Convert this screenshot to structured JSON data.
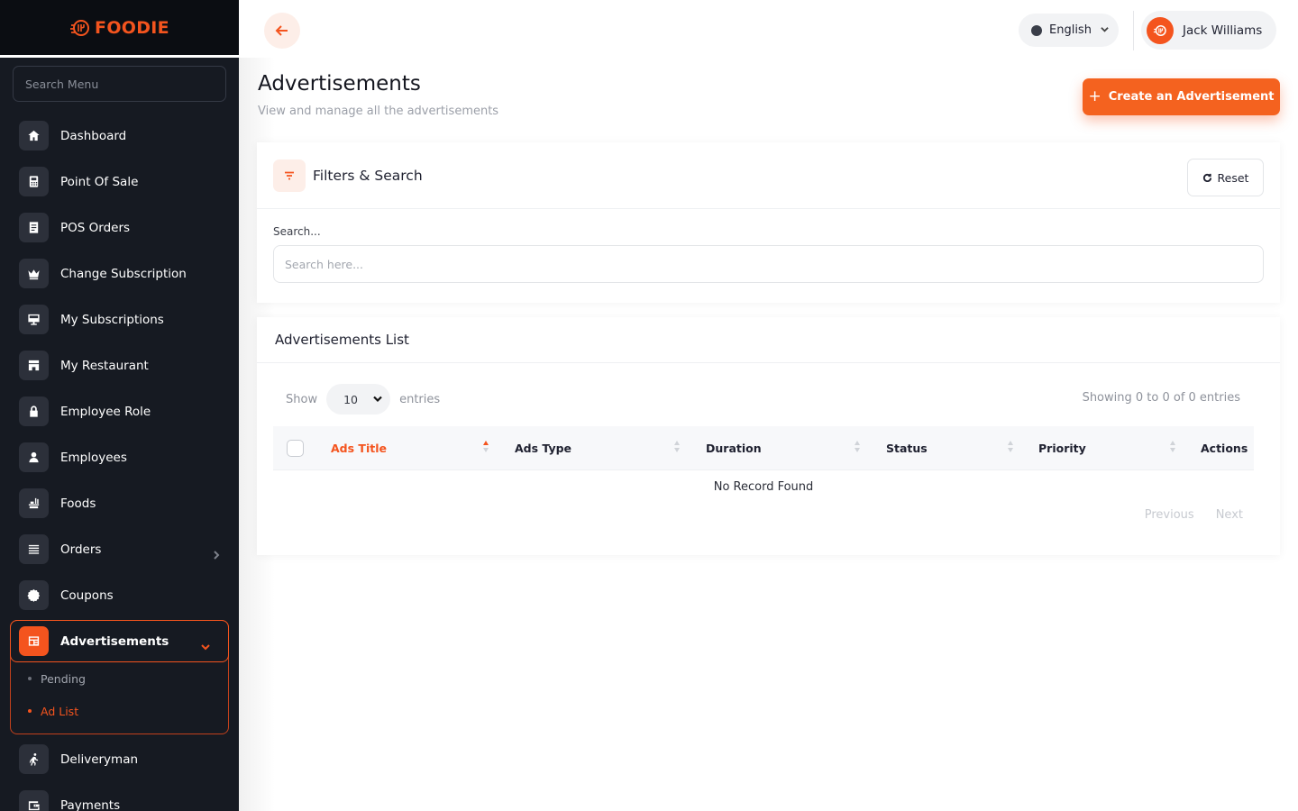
{
  "brand": {
    "name": "FOODIE",
    "color": "#f4541e"
  },
  "sidebar": {
    "search_placeholder": "Search Menu",
    "items": [
      {
        "label": "Dashboard",
        "icon": "home-icon"
      },
      {
        "label": "Point Of Sale",
        "icon": "calculator-icon"
      },
      {
        "label": "POS Orders",
        "icon": "receipt-icon"
      },
      {
        "label": "Change Subscription",
        "icon": "crown-icon"
      },
      {
        "label": "My Subscriptions",
        "icon": "monitor-icon"
      },
      {
        "label": "My Restaurant",
        "icon": "store-icon"
      },
      {
        "label": "Employee Role",
        "icon": "lock-icon"
      },
      {
        "label": "Employees",
        "icon": "user-icon"
      },
      {
        "label": "Foods",
        "icon": "food-icon"
      },
      {
        "label": "Orders",
        "icon": "list-icon"
      },
      {
        "label": "Coupons",
        "icon": "coupon-icon"
      }
    ],
    "active_group": {
      "label": "Advertisements",
      "icon": "advertisement-icon",
      "children": [
        {
          "label": "Pending",
          "active": false
        },
        {
          "label": "Ad List",
          "active": true
        }
      ]
    },
    "bottom_items": [
      {
        "label": "Deliveryman",
        "icon": "runner-icon"
      },
      {
        "label": "Payments",
        "icon": "wallet-icon"
      }
    ]
  },
  "topbar": {
    "language": "English",
    "user_name": "Jack Williams"
  },
  "page": {
    "title": "Advertisements",
    "subtitle": "View and manage all the advertisements",
    "create_button": "Create an Advertisement"
  },
  "filters": {
    "title": "Filters & Search",
    "reset_label": "Reset",
    "search_label": "Search...",
    "search_placeholder": "Search here...",
    "search_value": ""
  },
  "list": {
    "title": "Advertisements List",
    "show_label": "Show",
    "page_size": "10",
    "entries_label": "entries",
    "showing_text": "Showing 0 to 0 of 0 entries",
    "columns": [
      "Ads Title",
      "Ads Type",
      "Duration",
      "Status",
      "Priority",
      "Actions"
    ],
    "sorted_column": "Ads Title",
    "empty_text": "No Record Found",
    "pager": {
      "previous": "Previous",
      "next": "Next"
    }
  },
  "colors": {
    "accent": "#f4541e",
    "sidebar_bg": "#161a22",
    "logo_bar_bg": "#0b0d12"
  }
}
